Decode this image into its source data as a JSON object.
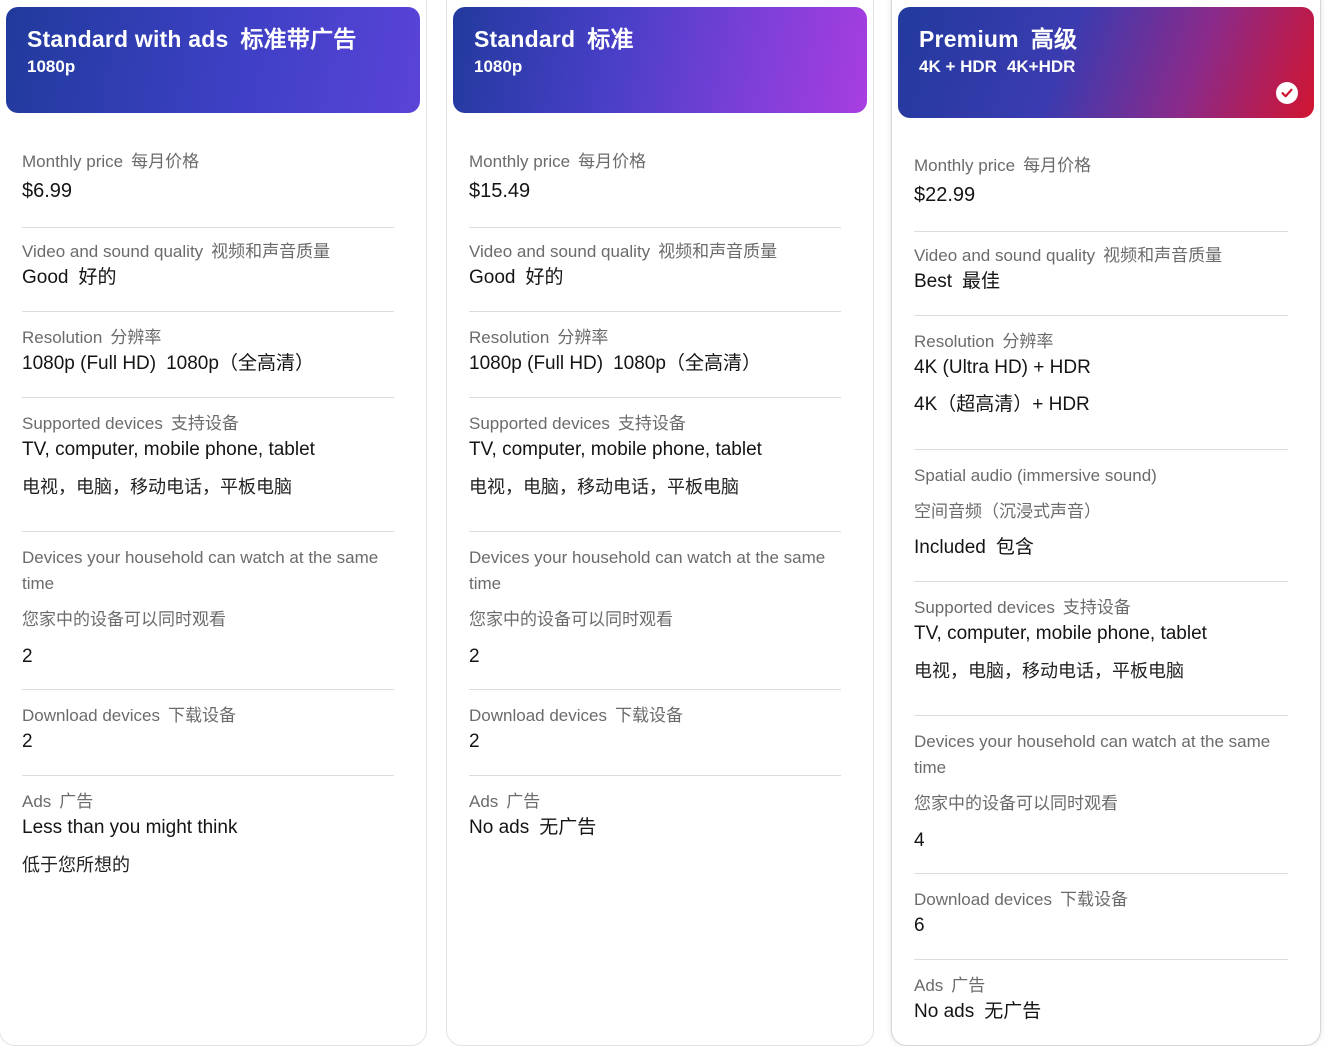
{
  "plans": [
    {
      "name": "Standard with ads",
      "name_cn": "标准带广告",
      "resolution_tag": "1080p",
      "resolution_tag_cn": "",
      "gradient": [
        "#213a9c",
        "#5a43d8"
      ],
      "selected": false,
      "monthly_price": {
        "label": "Monthly price",
        "label_cn": "每月价格",
        "value": "$6.99"
      },
      "quality": {
        "label": "Video and sound quality",
        "label_cn": "视频和声音质量",
        "value": "Good",
        "value_cn": "好的"
      },
      "resolution": {
        "label": "Resolution",
        "label_cn": "分辨率",
        "value": "1080p (Full HD)",
        "value_cn": "1080p（全高清）"
      },
      "devices": {
        "label": "Supported devices",
        "label_cn": "支持设备",
        "value": "TV, computer, mobile phone, tablet",
        "value_cn": "电视，电脑，移动电话，平板电脑"
      },
      "household": {
        "label": "Devices your household can watch at the same time",
        "label_cn": "您家中的设备可以同时观看",
        "value": "2"
      },
      "download": {
        "label": "Download devices",
        "label_cn": "下载设备",
        "value": "2"
      },
      "ads": {
        "label": "Ads",
        "label_cn": "广告",
        "value": "Less than you might think",
        "value_cn": "低于您所想的"
      }
    },
    {
      "name": "Standard",
      "name_cn": "标准",
      "resolution_tag": "1080p",
      "resolution_tag_cn": "",
      "gradient": [
        "#223a9e",
        "#9d3ee0"
      ],
      "selected": false,
      "monthly_price": {
        "label": "Monthly price",
        "label_cn": "每月价格",
        "value": "$15.49"
      },
      "quality": {
        "label": "Video and sound quality",
        "label_cn": "视频和声音质量",
        "value": "Good",
        "value_cn": "好的"
      },
      "resolution": {
        "label": "Resolution",
        "label_cn": "分辨率",
        "value": "1080p (Full HD)",
        "value_cn": "1080p（全高清）"
      },
      "devices": {
        "label": "Supported devices",
        "label_cn": "支持设备",
        "value": "TV, computer, mobile phone, tablet",
        "value_cn": "电视，电脑，移动电话，平板电脑"
      },
      "household": {
        "label": "Devices your household can watch at the same time",
        "label_cn": "您家中的设备可以同时观看",
        "value": "2"
      },
      "download": {
        "label": "Download devices",
        "label_cn": "下载设备",
        "value": "2"
      },
      "ads": {
        "label": "Ads",
        "label_cn": "广告",
        "value": "No ads",
        "value_cn": "无广告"
      }
    },
    {
      "name": "Premium",
      "name_cn": "高级",
      "resolution_tag": "4K + HDR",
      "resolution_tag_cn": "4K+HDR",
      "gradient": [
        "#223a9e",
        "#d11430"
      ],
      "selected": true,
      "monthly_price": {
        "label": "Monthly price",
        "label_cn": "每月价格",
        "value": "$22.99"
      },
      "quality": {
        "label": "Video and sound quality",
        "label_cn": "视频和声音质量",
        "value": "Best",
        "value_cn": "最佳"
      },
      "resolution": {
        "label": "Resolution",
        "label_cn": "分辨率",
        "value": "4K (Ultra HD) + HDR",
        "value_cn": "4K（超高清）+ HDR"
      },
      "spatial": {
        "label": "Spatial audio (immersive sound)",
        "label_cn": "空间音频（沉浸式声音）",
        "value": "Included",
        "value_cn": "包含"
      },
      "devices": {
        "label": "Supported devices",
        "label_cn": "支持设备",
        "value": "TV, computer, mobile phone, tablet",
        "value_cn": "电视，电脑，移动电话，平板电脑"
      },
      "household": {
        "label": "Devices your household can watch at the same time",
        "label_cn": "您家中的设备可以同时观看",
        "value": "4"
      },
      "download": {
        "label": "Download devices",
        "label_cn": "下载设备",
        "value": "6"
      },
      "ads": {
        "label": "Ads",
        "label_cn": "广告",
        "value": "No ads",
        "value_cn": "无广告"
      }
    }
  ]
}
